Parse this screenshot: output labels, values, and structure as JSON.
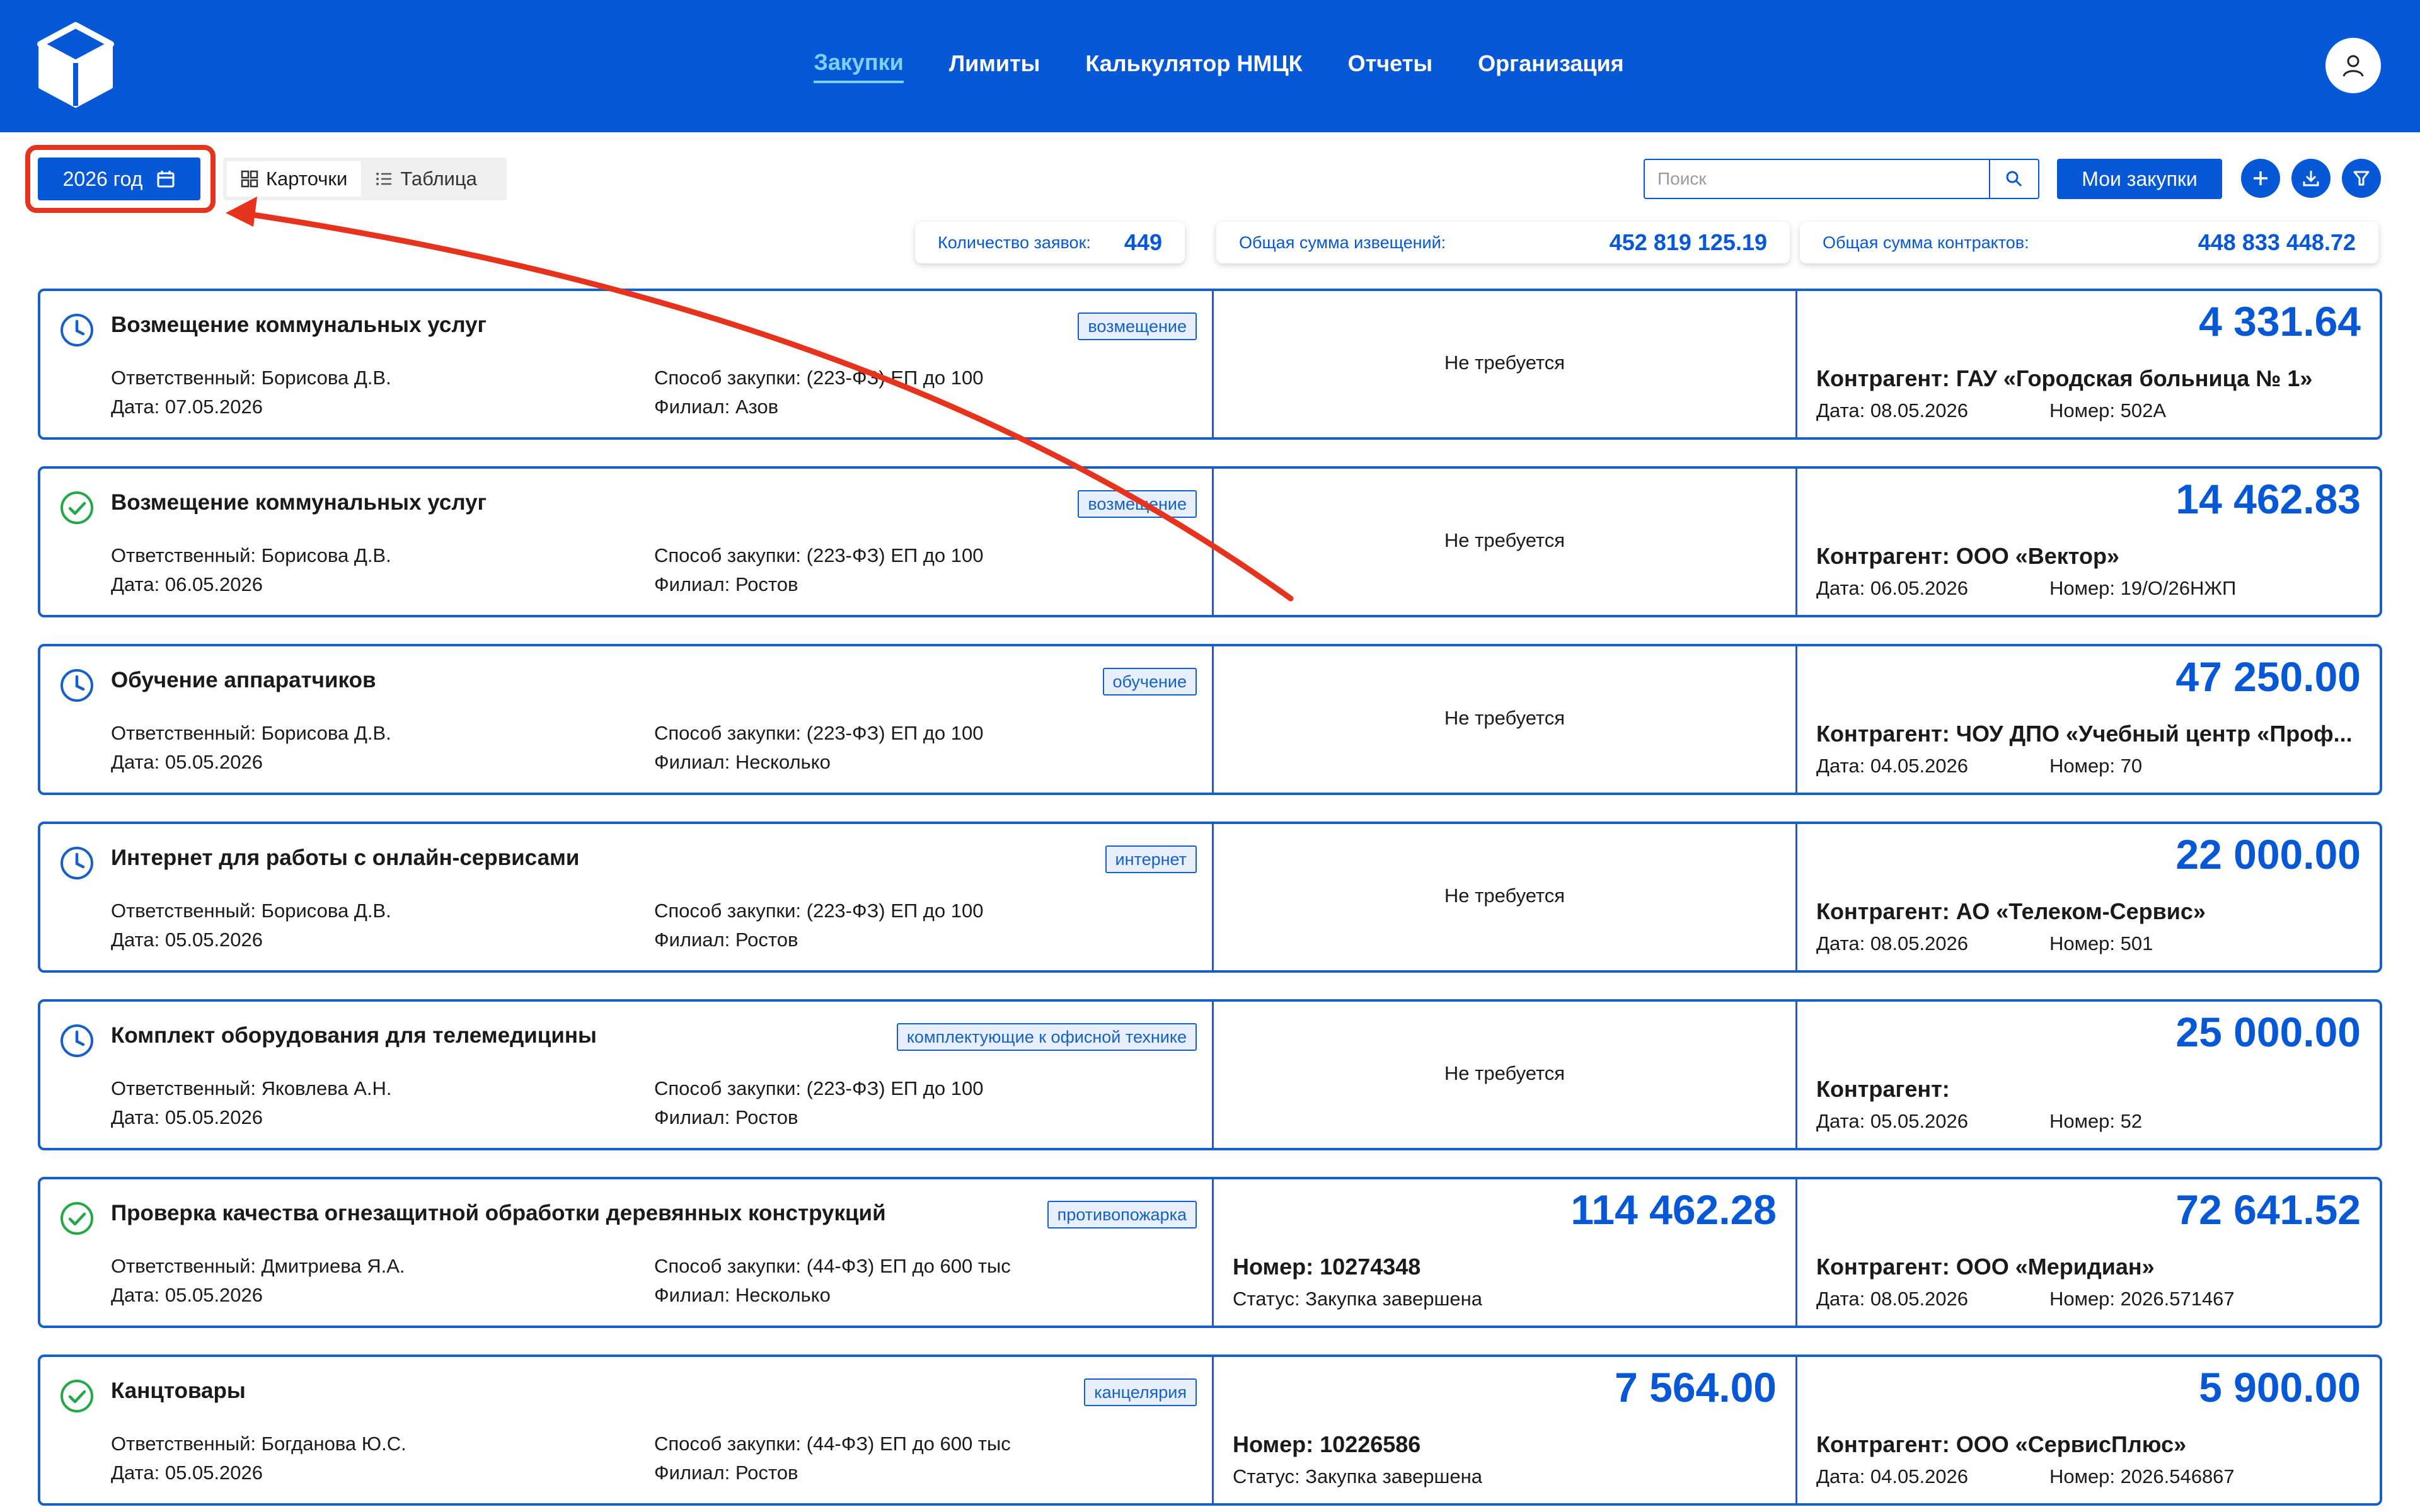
{
  "nav": {
    "items": [
      "Закупки",
      "Лимиты",
      "Калькулятор НМЦК",
      "Отчеты",
      "Организация"
    ]
  },
  "toolbar": {
    "year_label": "2026 год",
    "view_cards": "Карточки",
    "view_table": "Таблица",
    "search_placeholder": "Поиск",
    "my_purchases": "Мои закупки"
  },
  "stats": {
    "count_label": "Количество заявок:",
    "count_value": "449",
    "notices_label": "Общая сумма извещений:",
    "notices_value": "452 819 125.19",
    "contracts_label": "Общая сумма контрактов:",
    "contracts_value": "448 833 448.72"
  },
  "colors": {
    "primary": "#0658d6",
    "highlight": "#e5331e",
    "done": "#22a846"
  },
  "cards": [
    {
      "status": "clock",
      "title": "Возмещение коммунальных услуг",
      "tag": "возмещение",
      "responsible": "Ответственный: Борисова Д.В.",
      "date": "Дата: 07.05.2026",
      "method": "Способ закупки: (223-ФЗ) ЕП до 100",
      "branch": "Филиал: Азов",
      "notice_text": "Не требуется",
      "contract_amount": "4 331.64",
      "counterparty": "Контрагент: ГАУ «Городская больница № 1»",
      "contract_date": "Дата: 08.05.2026",
      "contract_number": "Номер: 502А"
    },
    {
      "status": "check",
      "title": "Возмещение коммунальных услуг",
      "tag": "возмещение",
      "responsible": "Ответственный: Борисова Д.В.",
      "date": "Дата: 06.05.2026",
      "method": "Способ закупки: (223-ФЗ) ЕП до 100",
      "branch": "Филиал: Ростов",
      "notice_text": "Не требуется",
      "contract_amount": "14 462.83",
      "counterparty": "Контрагент: ООО «Вектор»",
      "contract_date": "Дата: 06.05.2026",
      "contract_number": "Номер: 19/О/26НЖП"
    },
    {
      "status": "clock",
      "title": "Обучение аппаратчиков",
      "tag": "обучение",
      "responsible": "Ответственный: Борисова Д.В.",
      "date": "Дата: 05.05.2026",
      "method": "Способ закупки: (223-ФЗ) ЕП до 100",
      "branch": "Филиал: Несколько",
      "notice_text": "Не требуется",
      "contract_amount": "47 250.00",
      "counterparty": "Контрагент: ЧОУ ДПО «Учебный центр «Проф...",
      "contract_date": "Дата: 04.05.2026",
      "contract_number": "Номер: 70"
    },
    {
      "status": "clock",
      "title": "Интернет для работы с онлайн-сервисами",
      "tag": "интернет",
      "responsible": "Ответственный: Борисова Д.В.",
      "date": "Дата: 05.05.2026",
      "method": "Способ закупки: (223-ФЗ) ЕП до 100",
      "branch": "Филиал: Ростов",
      "notice_text": "Не требуется",
      "contract_amount": "22 000.00",
      "counterparty": "Контрагент: АО «Телеком-Сервис»",
      "contract_date": "Дата: 08.05.2026",
      "contract_number": "Номер: 501"
    },
    {
      "status": "clock",
      "title": "Комплект оборудования для телемедицины",
      "tag": "комплектующие к офисной технике",
      "responsible": "Ответственный: Яковлева А.Н.",
      "date": "Дата: 05.05.2026",
      "method": "Способ закупки: (223-ФЗ) ЕП до 100",
      "branch": "Филиал: Ростов",
      "notice_text": "Не требуется",
      "contract_amount": "25 000.00",
      "counterparty": "Контрагент:",
      "contract_date": "Дата: 05.05.2026",
      "contract_number": "Номер: 52"
    },
    {
      "status": "check",
      "title": "Проверка качества огнезащитной обработки деревянных конструкций",
      "tag": "противопожарка",
      "responsible": "Ответственный: Дмитриева Я.А.",
      "date": "Дата: 05.05.2026",
      "method": "Способ закупки: (44-ФЗ) ЕП до 600 тыс",
      "branch": "Филиал: Несколько",
      "notice_amount": "114 462.28",
      "notice_number": "Номер: 10274348",
      "notice_status": "Статус: Закупка завершена",
      "contract_amount": "72 641.52",
      "counterparty": "Контрагент: ООО «Меридиан»",
      "contract_date": "Дата: 08.05.2026",
      "contract_number": "Номер: 2026.571467"
    },
    {
      "status": "check",
      "title": "Канцтовары",
      "tag": "канцелярия",
      "responsible": "Ответственный: Богданова Ю.С.",
      "date": "Дата: 05.05.2026",
      "method": "Способ закупки: (44-ФЗ) ЕП до 600 тыс",
      "branch": "Филиал: Ростов",
      "notice_amount": "7 564.00",
      "notice_number": "Номер: 10226586",
      "notice_status": "Статус: Закупка завершена",
      "contract_amount": "5 900.00",
      "counterparty": "Контрагент: ООО «СервисПлюс»",
      "contract_date": "Дата: 04.05.2026",
      "contract_number": "Номер: 2026.546867"
    }
  ]
}
